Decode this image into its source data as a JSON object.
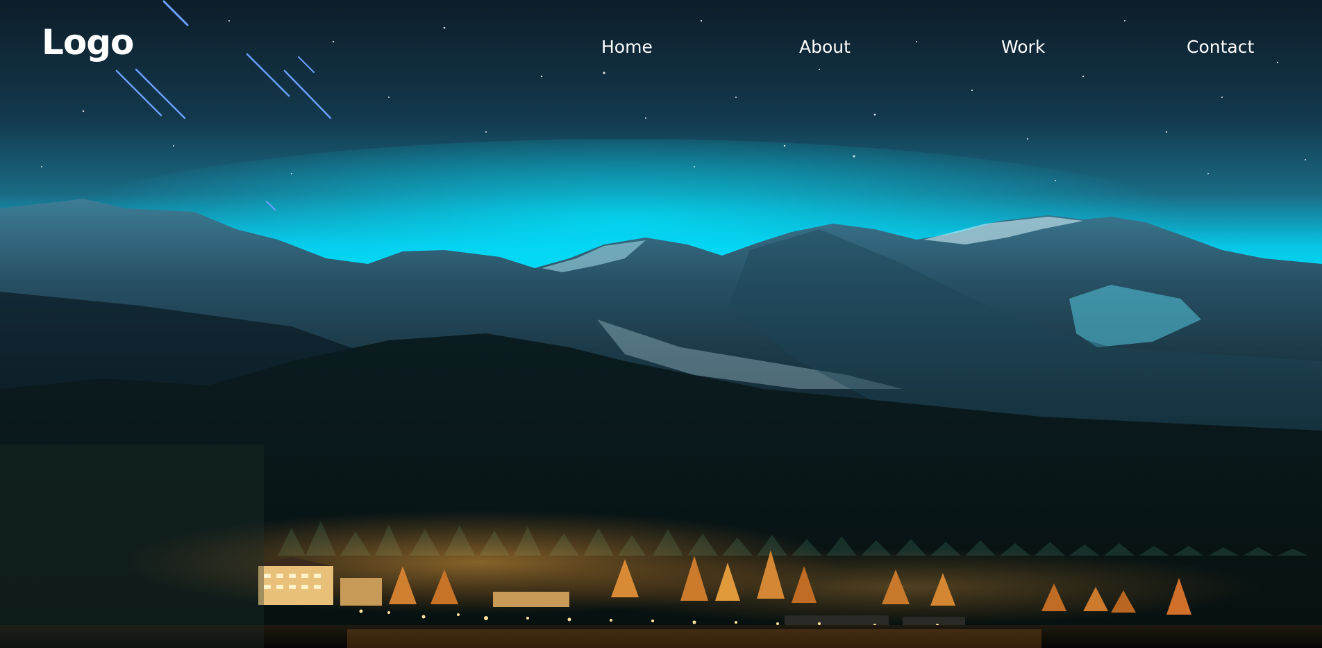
{
  "header": {
    "logo_text": "Logo"
  },
  "nav": {
    "items": [
      {
        "label": "Home"
      },
      {
        "label": "About"
      },
      {
        "label": "Work"
      },
      {
        "label": "Contact"
      }
    ]
  },
  "hero": {
    "background_description_icon": "night-mountain-landscape",
    "colors": {
      "sky_top": "#0b1f2e",
      "sky_glow": "#00d4f0",
      "lights": "#f0a030"
    }
  }
}
